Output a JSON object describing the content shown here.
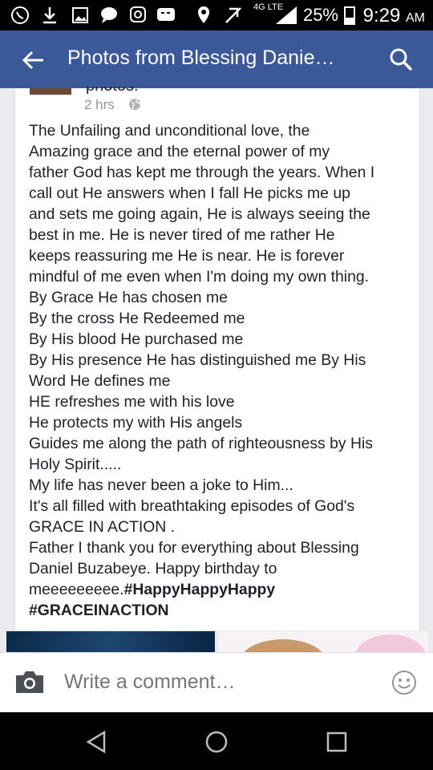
{
  "status_bar": {
    "network": "4G LTE",
    "battery": "25%",
    "time": "9:29",
    "ampm": "AM"
  },
  "app_bar": {
    "title": "Photos from Blessing Danie…"
  },
  "post": {
    "author_fragment": "photos.",
    "timestamp": "2 hrs",
    "body_lines": [
      "The Unfailing and unconditional love, the",
      "Amazing grace and the eternal power of my",
      "father God has kept me through the years. When I",
      "call out He answers when I fall He picks me up",
      "and sets me going again, He is always seeing the",
      "best in me. He is never tired of me rather He",
      "keeps reassuring me He is near. He is forever",
      "mindful of me even when I'm doing my own thing.",
      "By Grace He has chosen  me",
      "By the cross He Redeemed me",
      "By His blood He purchased me",
      "By His presence He has distinguished me  By His",
      "Word He defines me",
      "HE refreshes me with his love",
      "He protects my with His angels",
      "Guides me along the path of righteousness by His",
      "Holy Spirit.....",
      "My life has never been a joke to Him...",
      "It's all filled with breathtaking episodes of God's",
      "GRACE IN ACTION .",
      "Father I thank you for everything about Blessing",
      "Daniel Buzabeye. Happy birthday to"
    ],
    "last_line_prefix": "meeeeeeeee.",
    "hashtag1": "#HappyHappyHappy",
    "hashtag2": "#GRACEINACTION"
  },
  "composer": {
    "placeholder": "Write a comment…"
  },
  "colors": {
    "brand": "#3b5998",
    "text": "#1d2129",
    "muted": "#90949c"
  }
}
